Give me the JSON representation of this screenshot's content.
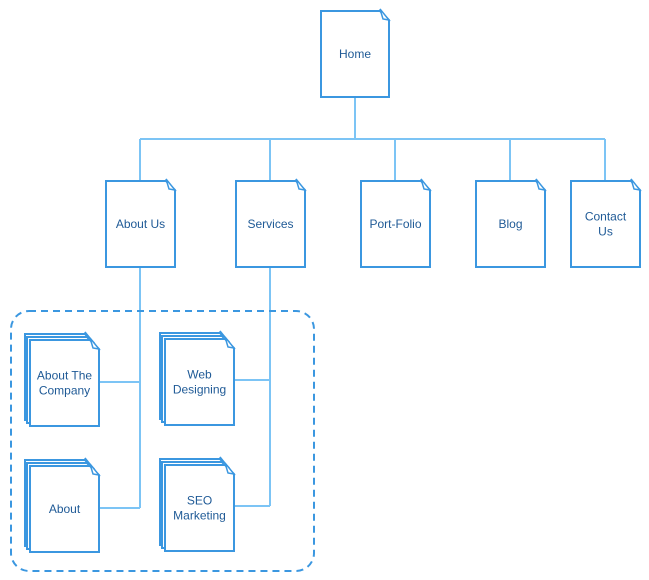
{
  "colors": {
    "node_stroke": "#3b97e0",
    "connector": "#7cc4f5",
    "text": "#1f5a96",
    "group_border": "#3b97e0"
  },
  "root": {
    "label": [
      "Home"
    ]
  },
  "level1": [
    {
      "id": "about-us",
      "label": [
        "About Us"
      ]
    },
    {
      "id": "services",
      "label": [
        "Services"
      ]
    },
    {
      "id": "port-folio",
      "label": [
        "Port-Folio"
      ]
    },
    {
      "id": "blog",
      "label": [
        "Blog"
      ]
    },
    {
      "id": "contact-us",
      "label": [
        "Contact",
        "Us"
      ]
    }
  ],
  "level2": [
    {
      "id": "about-the-company",
      "parent": "about-us",
      "label": [
        "About The",
        "Company"
      ]
    },
    {
      "id": "about",
      "parent": "about-us",
      "label": [
        "About"
      ]
    },
    {
      "id": "web-designing",
      "parent": "services",
      "label": [
        "Web",
        "Designing"
      ]
    },
    {
      "id": "seo-marketing",
      "parent": "services",
      "label": [
        "SEO",
        "Marketing"
      ]
    }
  ]
}
